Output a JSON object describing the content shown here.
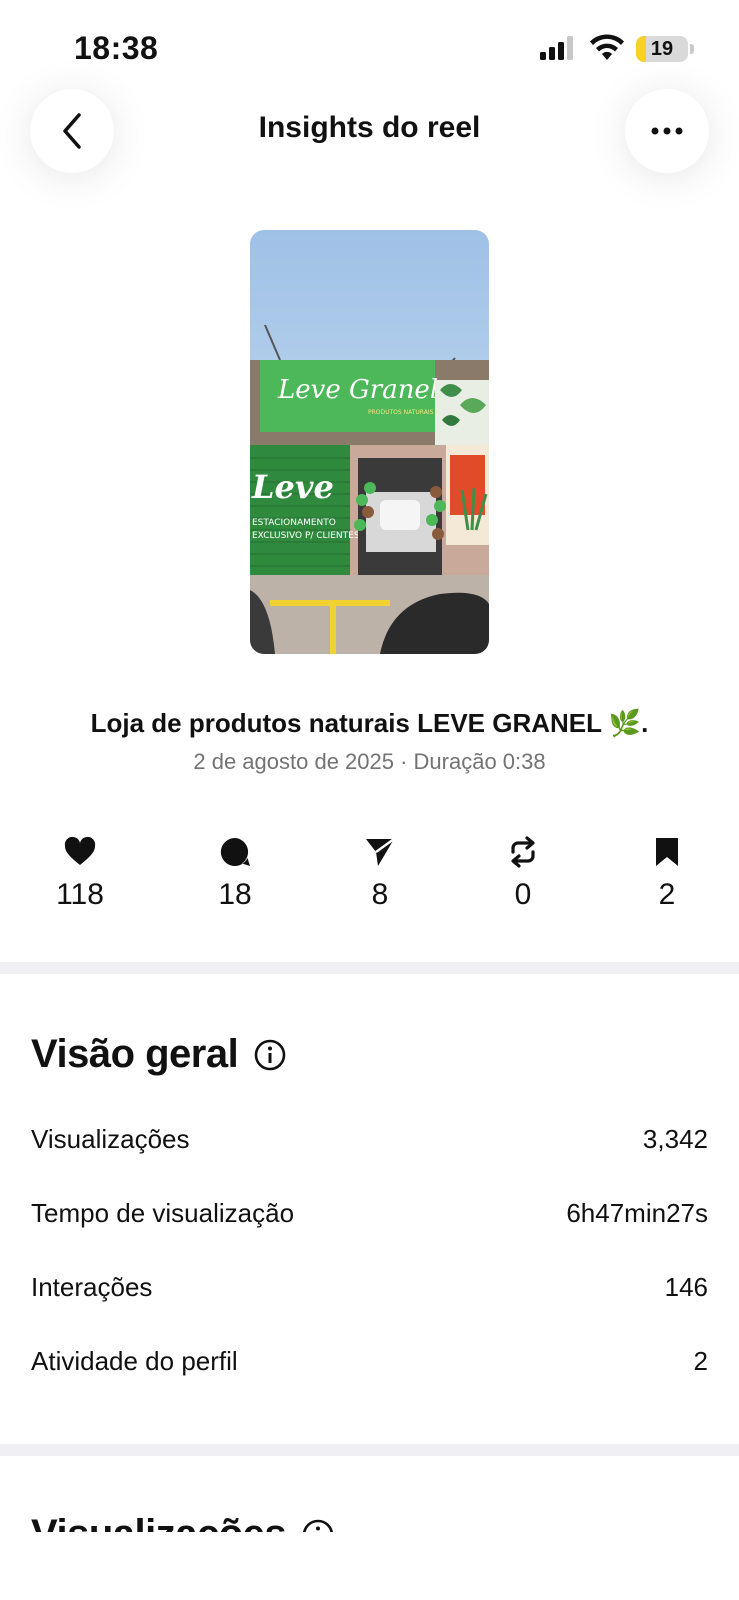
{
  "status_bar": {
    "time": "18:38",
    "battery": "19",
    "battery_level": 0.19
  },
  "header": {
    "title": "Insights do reel",
    "back_icon": "chevron-left-icon",
    "more_icon": "more-horizontal-icon"
  },
  "reel": {
    "caption": "Loja de produtos naturais LEVE GRANEL 🌿.",
    "meta": "2 de agosto de 2025 · Duração 0:38",
    "thumbnail": {
      "sign_title": "Leve Granel",
      "sign_subtitle": "PRODUTOS NATURAIS",
      "door_logo": "Leve",
      "door_text_1": "ESTACIONAMENTO",
      "door_text_2": "EXCLUSIVO P/ CLIENTES"
    }
  },
  "stats": [
    {
      "icon": "heart-icon",
      "value": "118"
    },
    {
      "icon": "comment-icon",
      "value": "18"
    },
    {
      "icon": "send-icon",
      "value": "8"
    },
    {
      "icon": "repost-icon",
      "value": "0"
    },
    {
      "icon": "bookmark-icon",
      "value": "2"
    }
  ],
  "overview": {
    "title": "Visão geral",
    "rows": [
      {
        "label": "Visualizações",
        "value": "3,342"
      },
      {
        "label": "Tempo de visualização",
        "value": "6h47min27s"
      },
      {
        "label": "Interações",
        "value": "146"
      },
      {
        "label": "Atividade do perfil",
        "value": "2"
      }
    ]
  },
  "views_section": {
    "title": "Visualizações"
  },
  "colors": {
    "accent_green": "#4cb85a",
    "divider": "#efeff4",
    "muted_text": "#737373",
    "battery_yellow": "#f5d225"
  }
}
